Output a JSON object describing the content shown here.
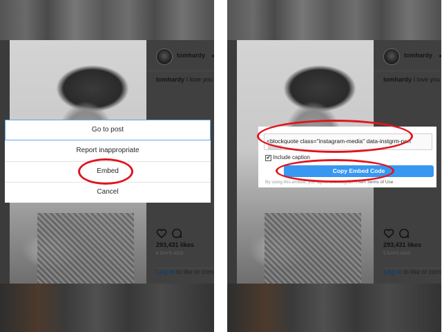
{
  "post": {
    "username": "tomhardy",
    "caption_user": "tomhardy",
    "caption_text": "I love you W",
    "likes": "293,431 likes",
    "time_ago": "6 DAYS AGO",
    "login_link": "Log in",
    "login_rest": " to like or comme"
  },
  "right_post": {
    "username": "tomhardy",
    "caption_user": "tomhardy",
    "caption_text": "I love you W",
    "likes": "293,431 likes",
    "time_ago": "5 DAYS AGO",
    "login_link": "Log in",
    "login_rest": " to like or comm"
  },
  "menu": {
    "items": [
      "Go to post",
      "Report inappropriate",
      "Embed",
      "Cancel"
    ]
  },
  "embed_dialog": {
    "code": "<blockquote class=\"instagram-media\" data-instgrm-peri",
    "include_caption": "Include caption",
    "include_caption_checked": true,
    "copy_button": "Copy Embed Code",
    "terms_prefix": "By using this embed, you agree to Instagram's ",
    "terms_link": "API Terms of Use"
  },
  "colors": {
    "highlight_ellipse": "#e0141e",
    "button_blue": "#3897f0"
  }
}
